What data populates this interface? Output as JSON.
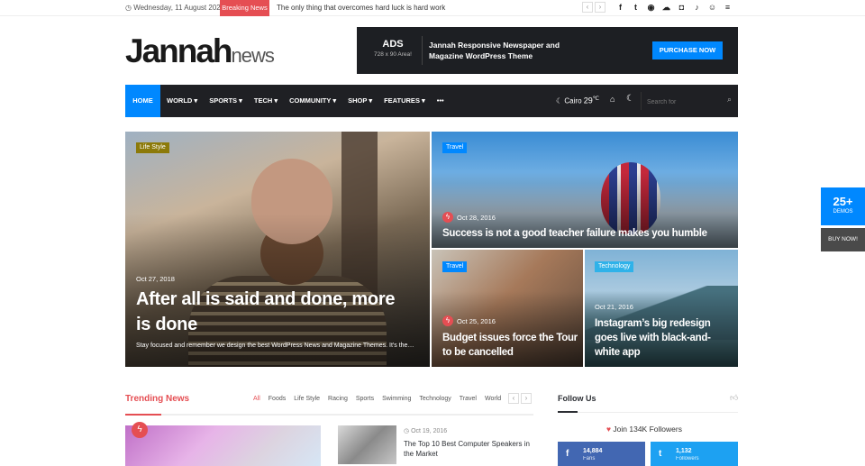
{
  "topbar": {
    "date": "Wednesday, 11 August 2021",
    "breaking_label": "Breaking News",
    "breaking_text": "The only thing that overcomes hard luck is hard work"
  },
  "logo": {
    "main": "Jannah",
    "sub": "news"
  },
  "ad": {
    "label": "ADS",
    "size": "728 x 90 Area!",
    "text": "Jannah Responsive Newspaper and Magazine WordPress Theme",
    "button": "PURCHASE NOW"
  },
  "nav": {
    "home": "HOME",
    "items": [
      "WORLD ▾",
      "SPORTS ▾",
      "TECH ▾",
      "COMMUNITY ▾",
      "SHOP ▾",
      "FEATURES ▾",
      "•••"
    ],
    "city": "Cairo",
    "temp": "29",
    "unit": "℃",
    "search_placeholder": "Search for"
  },
  "hero": {
    "main": {
      "tag": "Life Style",
      "date": "Oct 27, 2018",
      "title": "After all is said and done, more is done",
      "excerpt": "Stay focused and remember we design the best WordPress News and Magazine Themes. It's the…"
    },
    "top_right": {
      "tag": "Travel",
      "date": "Oct 28, 2016",
      "title": "Success is not a good teacher failure makes you humble"
    },
    "bottom_left": {
      "tag": "Travel",
      "date": "Oct 25, 2016",
      "title": "Budget issues force the Tour to be cancelled"
    },
    "bottom_right": {
      "tag": "Technology",
      "date": "Oct 21, 2016",
      "title": "Instagram’s big redesign goes live with black-and-white app"
    }
  },
  "trending": {
    "heading": "Trending News",
    "cats": [
      "All",
      "Foods",
      "Life Style",
      "Racing",
      "Sports",
      "Swimming",
      "Technology",
      "Travel",
      "World"
    ],
    "post_date": "Oct 19, 2016",
    "post_title": "The Top 10 Best Computer Speakers in the Market"
  },
  "follow": {
    "heading": "Follow Us",
    "join": "Join 134K Followers",
    "fb_count": "14,884",
    "fb_label": "Fans",
    "tw_count": "1,132",
    "tw_label": "Followers"
  },
  "side": {
    "demos_count": "25+",
    "demos_label": "DEMOS",
    "buy": "BUY NOW!"
  },
  "colors": {
    "accent": "#0088ff",
    "breaking": "#e54e53",
    "nav_bg": "#1f2024",
    "lifestyle_tag": "#8c7a0a",
    "travel_tag": "#0088ff",
    "tech_tag": "#2fb2e9"
  }
}
